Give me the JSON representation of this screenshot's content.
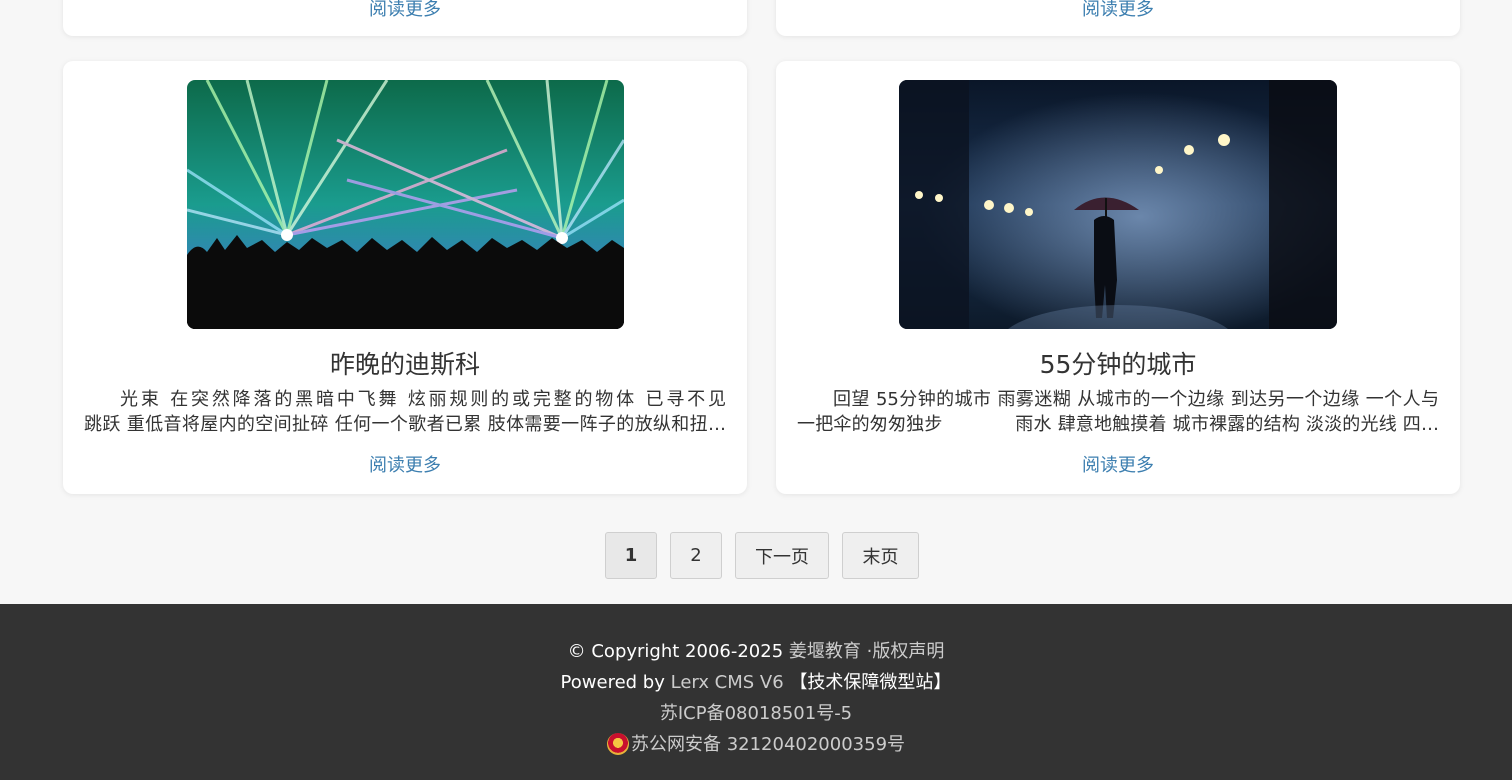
{
  "top_cards": {
    "left_more": "阅读更多",
    "right_more": "阅读更多"
  },
  "cards": [
    {
      "title": "昨晚的迪斯科",
      "excerpt": "光束 在突然降落的黑暗中飞舞 炫丽规则的或完整的物体 已寻不见　　　　跳跃 重低音将屋内的空间扯碎 任何一个歌者已累 肢体需要一阵子的放纵和扭曲 …",
      "more": "阅读更多",
      "image": "concert-laser-image"
    },
    {
      "title": "55分钟的城市",
      "excerpt": "回望 55分钟的城市 雨雾迷糊 从城市的一个边缘 到达另一个边缘 一个人与一把伞的匆匆独步　　　　雨水 肆意地触摸着 城市裸露的结构 淡淡的光线 四面八…",
      "more": "阅读更多",
      "image": "rainy-city-umbrella-image"
    }
  ],
  "pagination": {
    "pages": [
      "1",
      "2"
    ],
    "next": "下一页",
    "last": "末页",
    "current": "1"
  },
  "footer": {
    "copyright_prefix": "© Copyright 2006-2025",
    "org": "姜堰教育",
    "separator": "·",
    "rights": "版权声明",
    "powered_prefix": "Powered by",
    "cms": "Lerx CMS V6",
    "support": "【技术保障微型站】",
    "icp": "苏ICP备08018501号-5",
    "police": "苏公网安备 32120402000359号"
  },
  "colors": {
    "link": "#3d7fb0",
    "footer_bg": "#333333",
    "page_bg": "#f7f7f7"
  }
}
